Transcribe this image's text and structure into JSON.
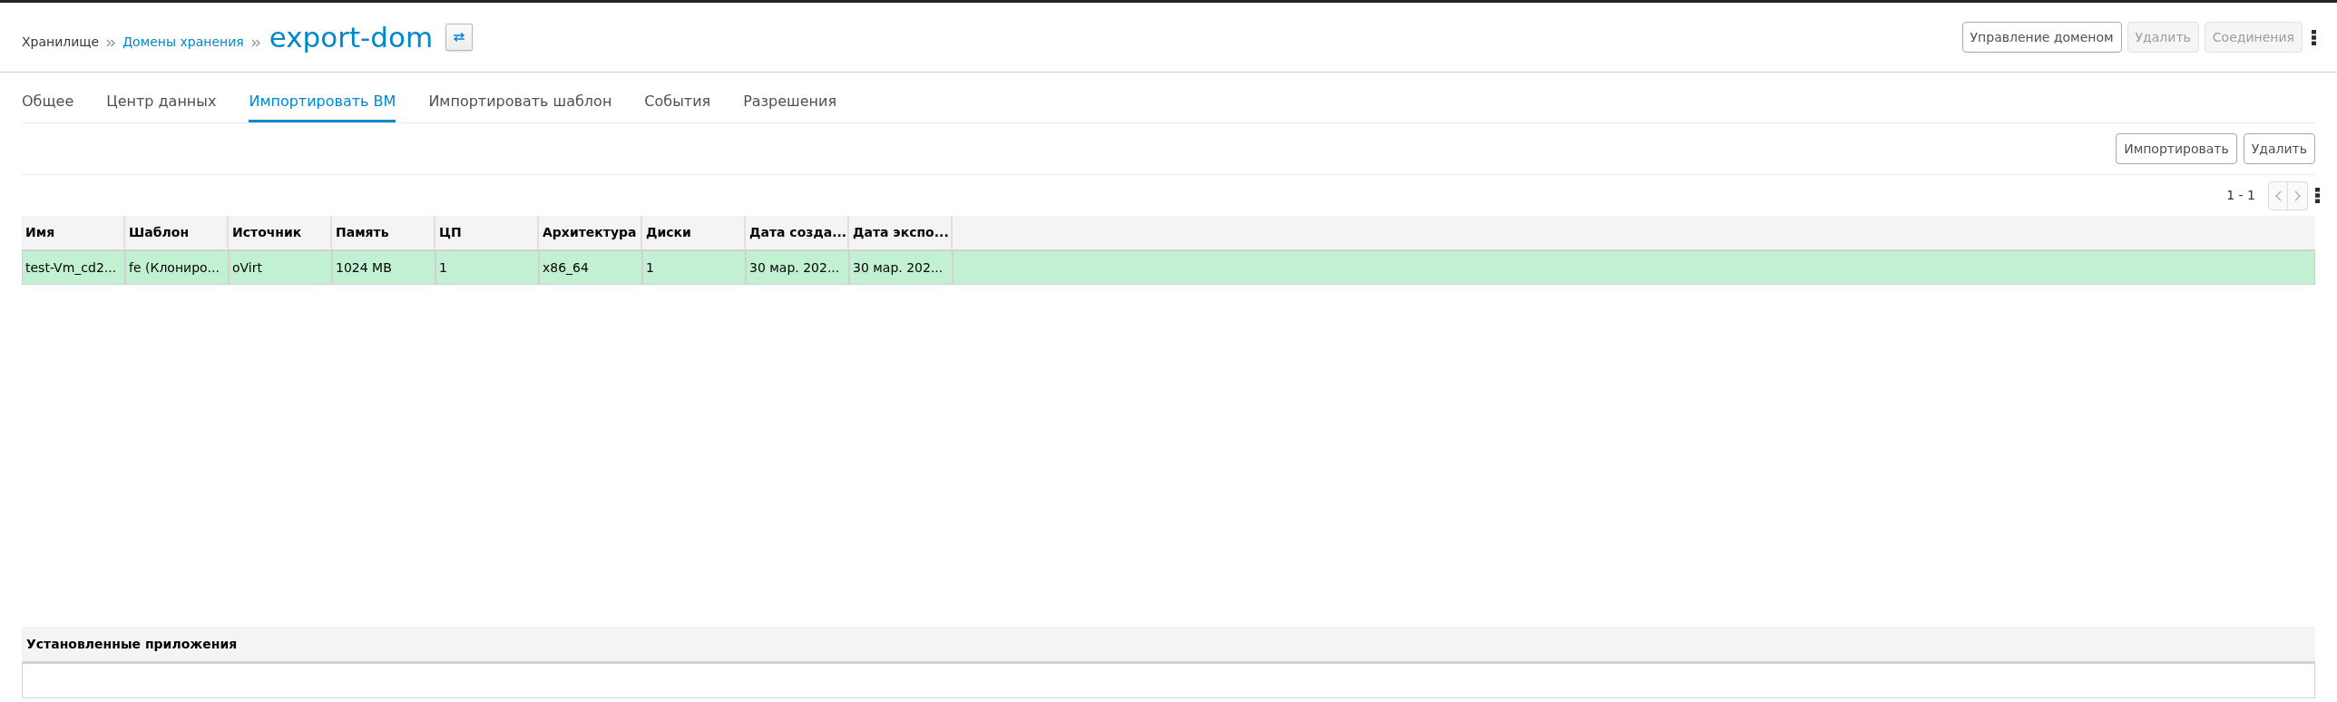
{
  "breadcrumb": [
    {
      "label": "Хранилище",
      "link": false
    },
    {
      "label": "Домены хранения",
      "link": true
    }
  ],
  "title": "export-dom",
  "header_actions": [
    {
      "label": "Управление доменом",
      "disabled": false
    },
    {
      "label": "Удалить",
      "disabled": true
    },
    {
      "label": "Соединения",
      "disabled": true
    }
  ],
  "tabs": [
    {
      "label": "Общее",
      "selected": false
    },
    {
      "label": "Центр данных",
      "selected": false
    },
    {
      "label": "Импортировать ВМ",
      "selected": true
    },
    {
      "label": "Импортировать шаблон",
      "selected": false
    },
    {
      "label": "События",
      "selected": false
    },
    {
      "label": "Разрешения",
      "selected": false
    }
  ],
  "toolbar_actions": [
    {
      "label": "Импортировать",
      "disabled": false
    },
    {
      "label": "Удалить",
      "disabled": false
    }
  ],
  "pagination": {
    "range": "1 - 1",
    "prev_disabled": true,
    "next_disabled": true
  },
  "table": {
    "columns": [
      "Имя",
      "Шаблон",
      "Источник",
      "Память",
      "ЦП",
      "Архитектура",
      "Диски",
      "Дата созда...",
      "Дата экспо..."
    ],
    "rows": [
      {
        "selected": true,
        "cells": [
          "test-Vm_cd2...",
          "fe (Клониро...",
          "oVirt",
          "1024 MB",
          "1",
          "x86_64",
          "1",
          "30 мар. 202...",
          "30 мар. 202..."
        ]
      }
    ]
  },
  "installed_apps": {
    "title": "Установленные приложения"
  }
}
